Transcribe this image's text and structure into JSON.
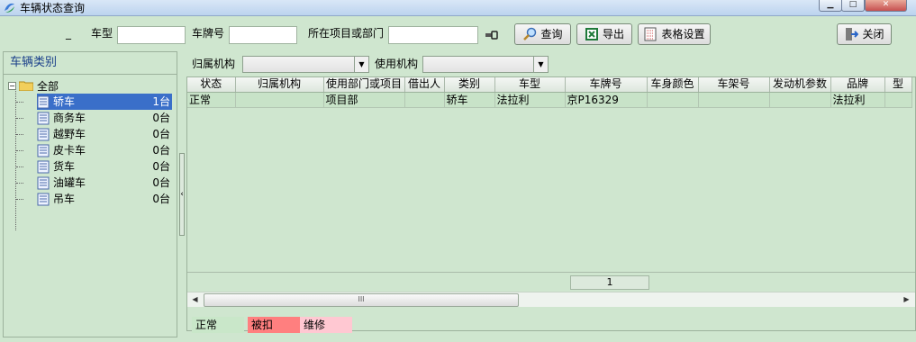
{
  "window": {
    "title": "车辆状态查询"
  },
  "toolbar": {
    "underscore": "_",
    "car_model_label": "车型",
    "car_model_value": "",
    "plate_label": "车牌号",
    "plate_value": "",
    "project_label": "所在项目或部门",
    "project_value": "",
    "query_label": "查询",
    "export_label": "导出",
    "grid_settings_label": "表格设置",
    "close_label": "关闭"
  },
  "sidebar": {
    "title": "车辆类别",
    "root": {
      "label": "全部",
      "expanded": true
    },
    "items": [
      {
        "label": "轿车",
        "count": "1台",
        "selected": true
      },
      {
        "label": "商务车",
        "count": "0台"
      },
      {
        "label": "越野车",
        "count": "0台"
      },
      {
        "label": "皮卡车",
        "count": "0台"
      },
      {
        "label": "货车",
        "count": "0台"
      },
      {
        "label": "油罐车",
        "count": "0台"
      },
      {
        "label": "吊车",
        "count": "0台"
      }
    ]
  },
  "filters": {
    "owner_org_label": "归属机构",
    "owner_org_value": "",
    "user_org_label": "使用机构",
    "user_org_value": ""
  },
  "grid": {
    "columns": [
      "状态",
      "归属机构",
      "使用部门或项目",
      "借出人",
      "类别",
      "车型",
      "车牌号",
      "车身颜色",
      "车架号",
      "发动机参数",
      "品牌",
      "型"
    ],
    "rows": [
      [
        "正常",
        "",
        "项目部",
        "",
        "轿车",
        "法拉利",
        "京P16329",
        "",
        "",
        "",
        "法拉利",
        ""
      ]
    ],
    "row_count": "1",
    "scroll_thumb": "III"
  },
  "legend": [
    {
      "label": "正常",
      "color": "#c9e7c9"
    },
    {
      "label": "被扣",
      "color": "#ff7f7f"
    },
    {
      "label": "维修",
      "color": "#ffc8d2"
    }
  ],
  "colors": {
    "background": "#cfe6cf",
    "selection": "#3a6fc9",
    "category_title": "#1a3f8a"
  },
  "icons": {
    "app": "app-logo-icon",
    "query": "magnifier-icon",
    "export": "excel-icon",
    "settings": "grid-settings-icon",
    "close": "exit-door-icon",
    "clear": "clear-key-icon",
    "folder": "folder-icon",
    "doc": "document-icon"
  }
}
